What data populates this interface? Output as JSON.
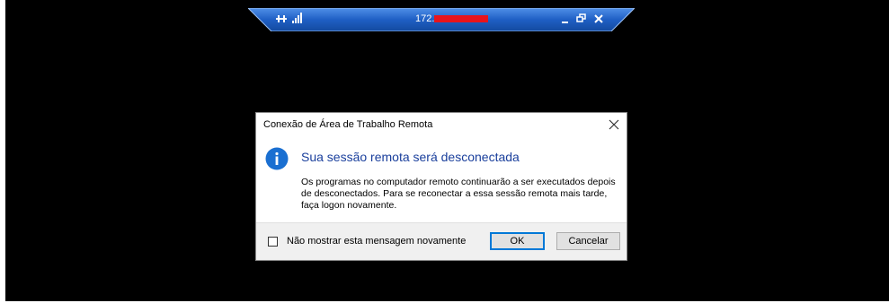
{
  "connection_bar": {
    "title": "172.",
    "colors": {
      "bar_fill": "#1f5fc4",
      "redaction": "#e8141c"
    },
    "icons": [
      "pin-icon",
      "signal-strength-icon",
      "minimize-icon",
      "restore-icon",
      "close-icon"
    ]
  },
  "dialog": {
    "title": "Conexão de Área de Trabalho Remota",
    "heading": "Sua sessão remota será desconectada",
    "body": "Os programas no computador remoto continuarão a ser executados depois de desconectados. Para se reconectar a essa sessão remota mais tarde, faça logon novamente.",
    "checkbox_label": "Não mostrar esta mensagem novamente",
    "checkbox_checked": false,
    "ok_label": "OK",
    "cancel_label": "Cancelar",
    "icons": [
      "info-icon",
      "close-icon"
    ],
    "colors": {
      "heading": "#1a3f9c",
      "info_icon": "#1a6fd1",
      "default_button_border": "#0078d7"
    }
  }
}
